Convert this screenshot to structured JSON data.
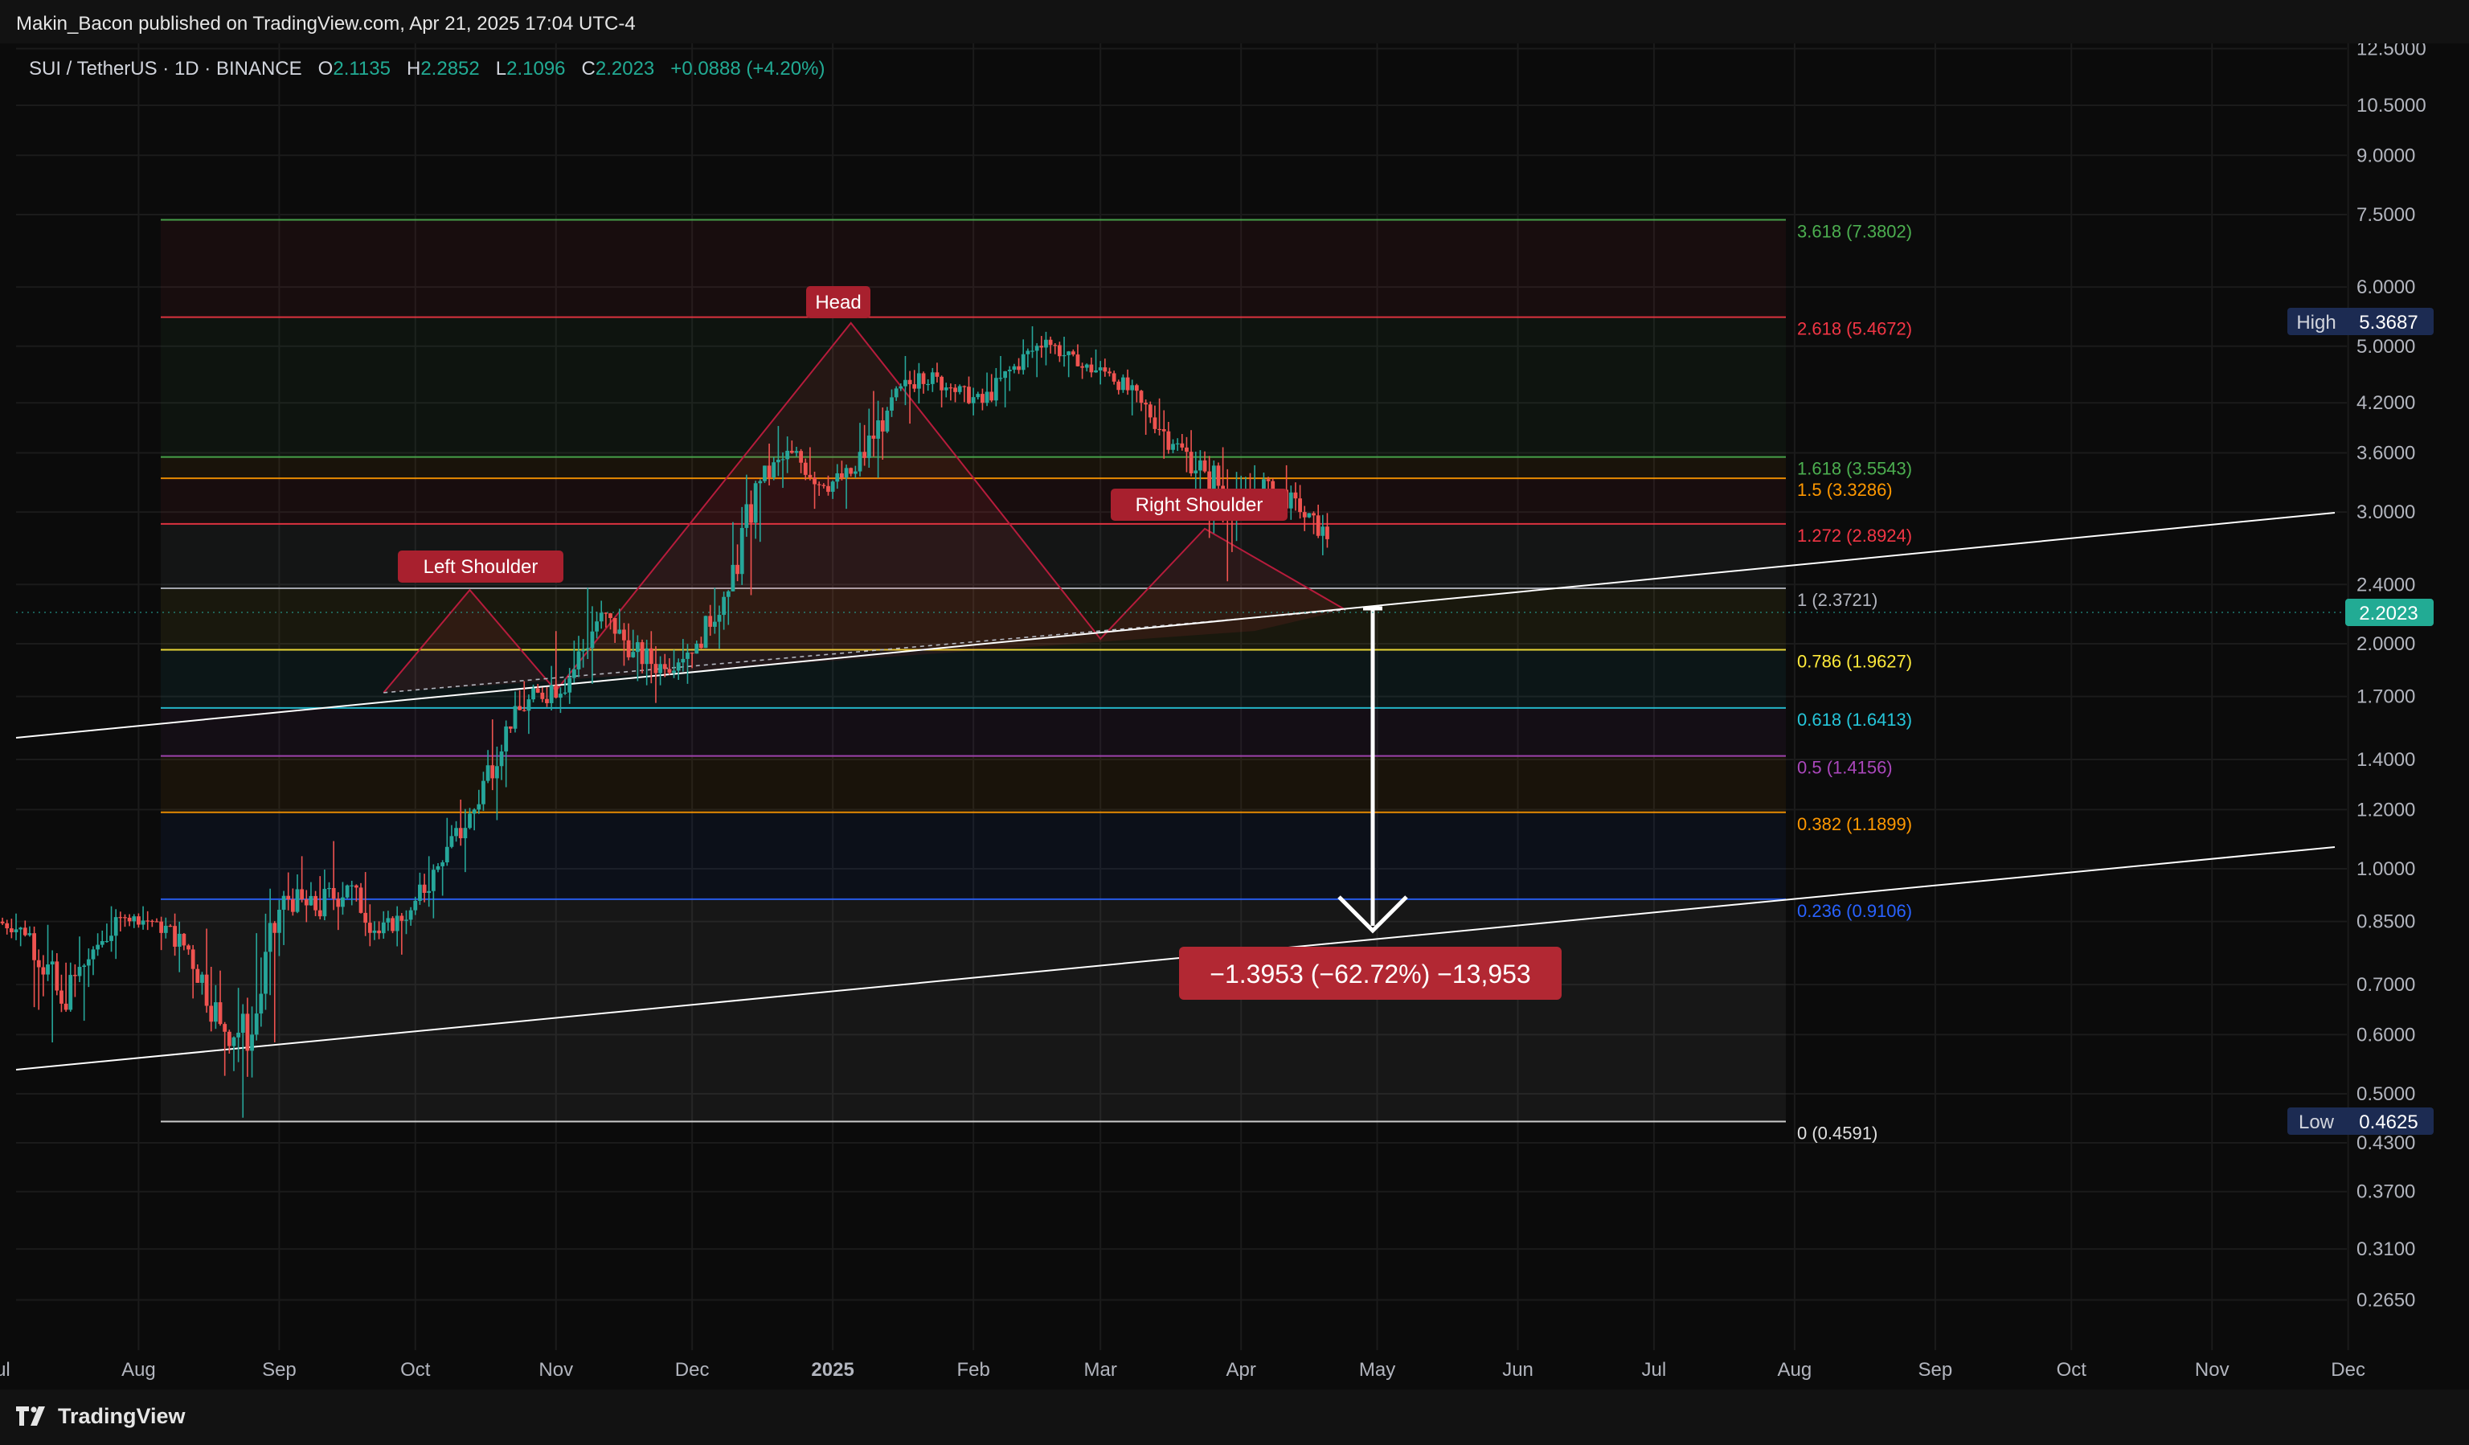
{
  "publisher": "Makin_Bacon published on TradingView.com, Apr 21, 2025 17:04 UTC-4",
  "symbol": {
    "name": "SUI / TetherUS · 1D · BINANCE",
    "o_label": "O",
    "o": "2.1135",
    "h_label": "H",
    "h": "2.2852",
    "l_label": "L",
    "l": "2.1096",
    "c_label": "C",
    "c": "2.2023",
    "change": "+0.0888 (+4.20%)"
  },
  "footer": {
    "brand": "TradingView"
  },
  "chart_data": {
    "type": "candlestick",
    "y_scale": "log",
    "ylim": [
      0.23,
      12.8
    ],
    "price_axis_ticks": [
      "12.5000",
      "10.5000",
      "9.0000",
      "7.5000",
      "6.0000",
      "5.0000",
      "4.2000",
      "3.6000",
      "3.0000",
      "2.4000",
      "2.0000",
      "1.7000",
      "1.4000",
      "1.2000",
      "1.0000",
      "0.8500",
      "0.7000",
      "0.6000",
      "0.5000",
      "0.4300",
      "0.3700",
      "0.3100",
      "0.2650"
    ],
    "time_axis_ticks": [
      "Jul",
      "Aug",
      "Sep",
      "Oct",
      "Nov",
      "Dec",
      "2025",
      "Feb",
      "Mar",
      "Apr",
      "May",
      "Jun",
      "Jul",
      "Aug",
      "Sep",
      "Oct",
      "Nov",
      "Dec"
    ],
    "time_axis_start": "2024-07-01",
    "current_price": "2.2023",
    "high_marker": {
      "label": "High",
      "value": "5.3687"
    },
    "low_marker": {
      "label": "Low",
      "value": "0.4625"
    },
    "fib_levels": [
      {
        "label": "3.618 (7.3802)",
        "value": 7.3802,
        "color": "#4caf50"
      },
      {
        "label": "2.618 (5.4672)",
        "value": 5.4672,
        "color": "#f23645"
      },
      {
        "label": "1.618 (3.5543)",
        "value": 3.5543,
        "color": "#4caf50"
      },
      {
        "label": "1.5 (3.3286)",
        "value": 3.3286,
        "color": "#ff9800"
      },
      {
        "label": "1.272 (2.8924)",
        "value": 2.8924,
        "color": "#f23645"
      },
      {
        "label": "1 (2.3721)",
        "value": 2.3721,
        "color": "#b2b5be"
      },
      {
        "label": "0.786 (1.9627)",
        "value": 1.9627,
        "color": "#ffeb3b"
      },
      {
        "label": "0.618 (1.6413)",
        "value": 1.6413,
        "color": "#26c6da"
      },
      {
        "label": "0.5 (1.4156)",
        "value": 1.4156,
        "color": "#ab47bc"
      },
      {
        "label": "0.382 (1.1899)",
        "value": 1.1899,
        "color": "#ff9800"
      },
      {
        "label": "0.236 (0.9106)",
        "value": 0.9106,
        "color": "#2962ff"
      },
      {
        "label": "0 (0.4591)",
        "value": 0.4591,
        "color": "#e0e0e0"
      }
    ],
    "annotations": [
      "Left Shoulder",
      "Head",
      "Right Shoulder"
    ],
    "measure_label": "−1.3953 (−62.72%) −13,953",
    "ohlc_weekly_approx": [
      [
        0.85,
        0.88,
        0.78,
        0.82
      ],
      [
        0.82,
        0.85,
        0.58,
        0.66
      ],
      [
        0.66,
        0.82,
        0.62,
        0.78
      ],
      [
        0.78,
        0.9,
        0.75,
        0.86
      ],
      [
        0.86,
        0.9,
        0.82,
        0.85
      ],
      [
        0.85,
        0.88,
        0.72,
        0.78
      ],
      [
        0.78,
        0.84,
        0.6,
        0.62
      ],
      [
        0.62,
        0.7,
        0.46,
        0.6
      ],
      [
        0.6,
        0.95,
        0.58,
        0.92
      ],
      [
        0.92,
        1.05,
        0.84,
        0.88
      ],
      [
        0.88,
        1.1,
        0.82,
        0.95
      ],
      [
        0.95,
        1.0,
        0.78,
        0.82
      ],
      [
        0.82,
        0.9,
        0.76,
        0.88
      ],
      [
        0.88,
        1.05,
        0.85,
        1.02
      ],
      [
        1.02,
        1.25,
        0.98,
        1.2
      ],
      [
        1.2,
        1.6,
        1.15,
        1.55
      ],
      [
        1.55,
        1.8,
        1.5,
        1.72
      ],
      [
        1.72,
        2.1,
        1.6,
        1.8
      ],
      [
        1.8,
        2.4,
        1.75,
        2.2
      ],
      [
        2.2,
        2.25,
        1.85,
        1.95
      ],
      [
        1.95,
        2.1,
        1.65,
        1.85
      ],
      [
        1.85,
        2.05,
        1.75,
        2.0
      ],
      [
        2.0,
        2.4,
        1.95,
        2.35
      ],
      [
        2.35,
        3.4,
        2.3,
        3.3
      ],
      [
        3.3,
        3.95,
        3.2,
        3.6
      ],
      [
        3.6,
        3.7,
        3.0,
        3.25
      ],
      [
        3.25,
        3.55,
        3.0,
        3.4
      ],
      [
        3.4,
        4.4,
        3.3,
        4.1
      ],
      [
        4.1,
        4.9,
        3.9,
        4.6
      ],
      [
        4.6,
        4.8,
        4.1,
        4.4
      ],
      [
        4.4,
        4.6,
        4.0,
        4.2
      ],
      [
        4.2,
        4.9,
        4.1,
        4.7
      ],
      [
        4.7,
        5.37,
        4.5,
        5.1
      ],
      [
        5.1,
        5.2,
        4.5,
        4.7
      ],
      [
        4.7,
        5.0,
        4.4,
        4.6
      ],
      [
        4.6,
        4.7,
        4.0,
        4.2
      ],
      [
        4.2,
        4.3,
        3.5,
        3.7
      ],
      [
        3.7,
        3.9,
        3.0,
        3.4
      ],
      [
        3.4,
        3.7,
        2.4,
        3.1
      ],
      [
        3.1,
        3.5,
        3.0,
        3.3
      ],
      [
        3.3,
        3.5,
        2.9,
        3.0
      ],
      [
        3.0,
        3.1,
        2.6,
        2.75
      ],
      [
        2.75,
        2.9,
        2.4,
        2.55
      ],
      [
        2.55,
        2.7,
        2.05,
        2.3
      ],
      [
        2.3,
        2.5,
        2.15,
        2.4
      ],
      [
        2.4,
        2.55,
        2.25,
        2.45
      ],
      [
        2.45,
        2.85,
        2.4,
        2.7
      ],
      [
        2.7,
        2.75,
        2.25,
        2.35
      ],
      [
        2.35,
        2.45,
        1.8,
        2.05
      ],
      [
        2.05,
        2.25,
        2.0,
        2.15
      ],
      [
        2.15,
        2.29,
        2.1,
        2.2
      ]
    ]
  }
}
